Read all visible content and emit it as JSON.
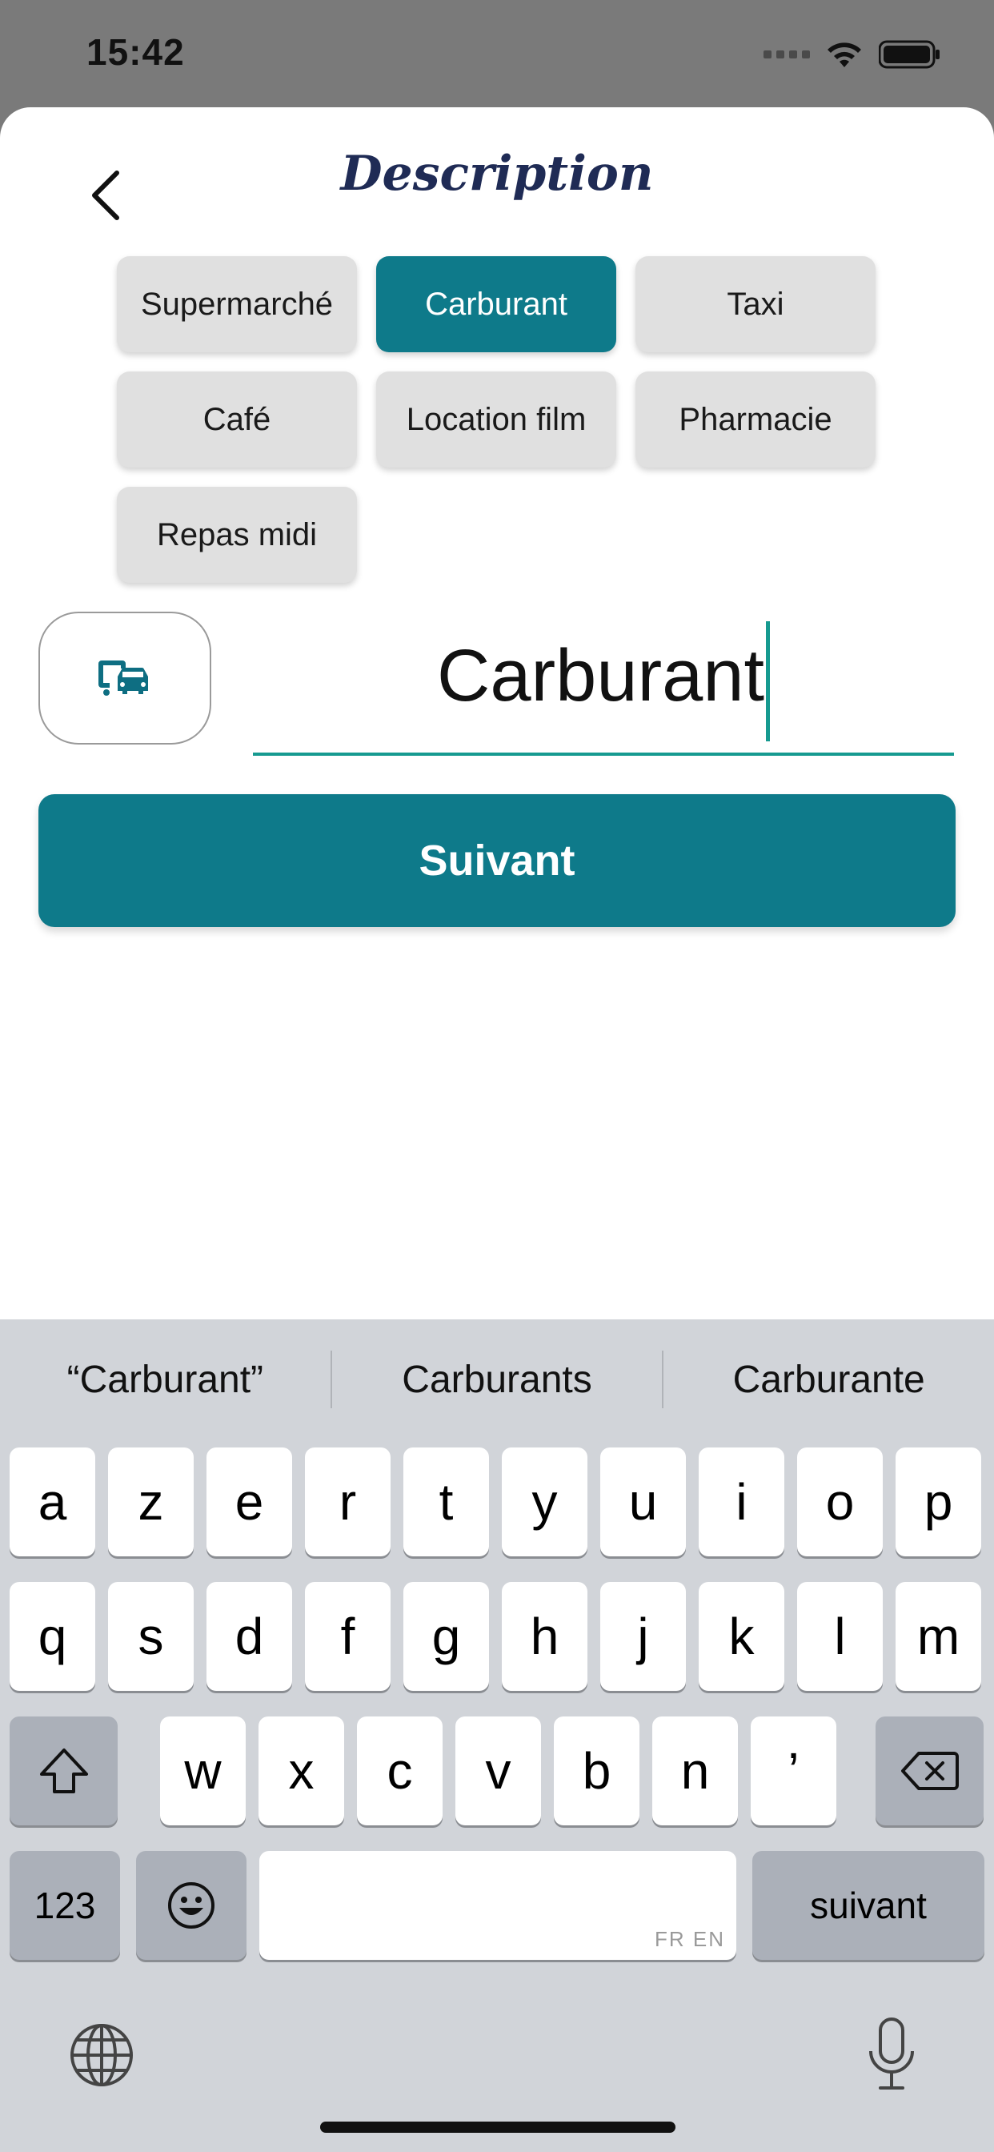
{
  "status_bar": {
    "time": "15:42"
  },
  "header": {
    "title": "Description"
  },
  "chips": [
    {
      "label": "Supermarché",
      "active": false
    },
    {
      "label": "Carburant",
      "active": true
    },
    {
      "label": "Taxi",
      "active": false
    },
    {
      "label": "Café",
      "active": false
    },
    {
      "label": "Location film",
      "active": false
    },
    {
      "label": "Pharmacie",
      "active": false
    },
    {
      "label": "Repas midi",
      "active": false
    }
  ],
  "description_input": {
    "value": "Carburant"
  },
  "next_button": {
    "label": "Suivant"
  },
  "colors": {
    "accent": "#0e7a8a",
    "underline": "#169a90",
    "title": "#1f2b55",
    "chip_bg": "#e0e0e0"
  },
  "keyboard": {
    "suggestions": [
      "“Carburant”",
      "Carburants",
      "Carburante"
    ],
    "row1": [
      "a",
      "z",
      "e",
      "r",
      "t",
      "y",
      "u",
      "i",
      "o",
      "p"
    ],
    "row2": [
      "q",
      "s",
      "d",
      "f",
      "g",
      "h",
      "j",
      "k",
      "l",
      "m"
    ],
    "row3": [
      "w",
      "x",
      "c",
      "v",
      "b",
      "n",
      "’"
    ],
    "numbers_label": "123",
    "return_label": "suivant",
    "space_languages": "FR EN"
  }
}
